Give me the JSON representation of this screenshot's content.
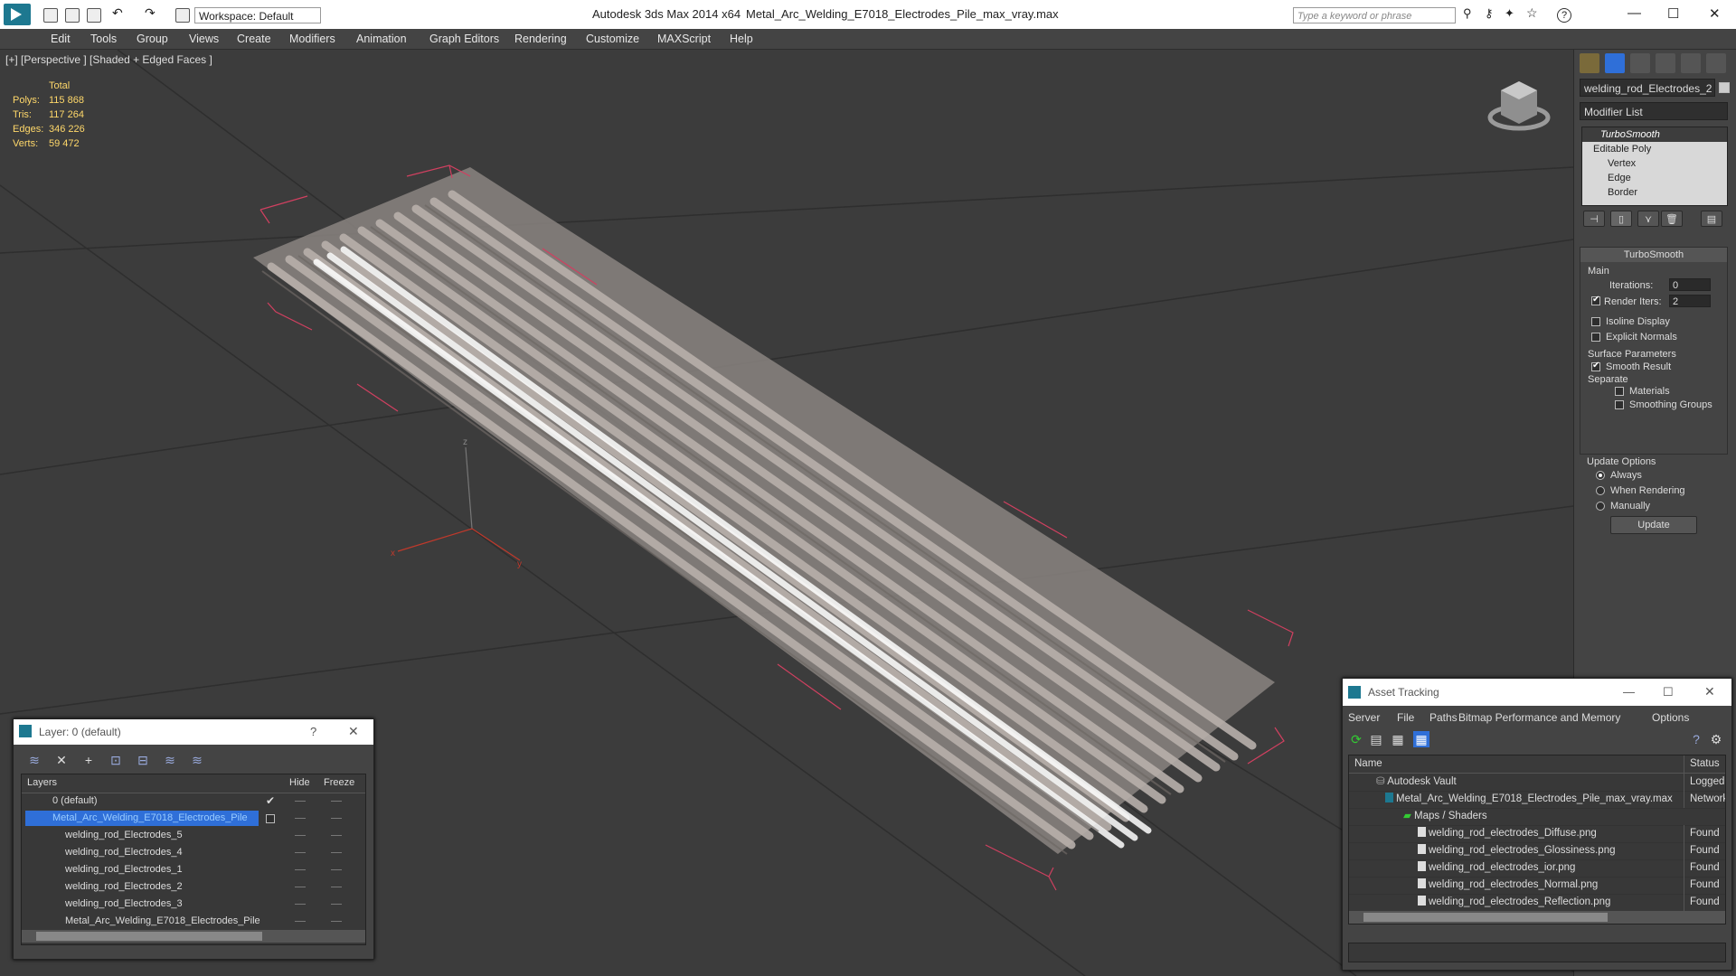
{
  "titlebar": {
    "app": "Autodesk 3ds Max  2014 x64",
    "file": "Metal_Arc_Welding_E7018_Electrodes_Pile_max_vray.max",
    "workspace": "Workspace: Default",
    "search_placeholder": "Type a keyword or phrase"
  },
  "menu": [
    "Edit",
    "Tools",
    "Group",
    "Views",
    "Create",
    "Modifiers",
    "Animation",
    "Graph Editors",
    "Rendering",
    "Customize",
    "MAXScript",
    "Help"
  ],
  "viewport": {
    "label": "[+] [Perspective ] [Shaded + Edged Faces ]",
    "stats": {
      "header": "Total",
      "rows": [
        {
          "label": "Polys:",
          "value": "115 868"
        },
        {
          "label": "Tris:",
          "value": "117 264"
        },
        {
          "label": "Edges:",
          "value": "346 226"
        },
        {
          "label": "Verts:",
          "value": "59 472"
        }
      ]
    },
    "axis": {
      "x": "x",
      "y": "y",
      "z": "z"
    }
  },
  "command_panel": {
    "object_name": "welding_rod_Electrodes_2",
    "modifier_list": "Modifier List",
    "stack": [
      "TurboSmooth",
      "Editable Poly",
      "Vertex",
      "Edge",
      "Border"
    ],
    "rollout_title": "TurboSmooth",
    "main_label": "Main",
    "iterations_label": "Iterations:",
    "iterations_value": "0",
    "render_iters_label": "Render Iters:",
    "render_iters_value": "2",
    "isoline": "Isoline Display",
    "explicit_normals": "Explicit Normals",
    "surface_params": "Surface Parameters",
    "smooth_result": "Smooth Result",
    "separate": "Separate",
    "materials": "Materials",
    "smoothing_groups": "Smoothing Groups",
    "update_options": "Update Options",
    "always": "Always",
    "when_rendering": "When Rendering",
    "manually": "Manually",
    "update_button": "Update"
  },
  "layer_window": {
    "title": "Layer: 0 (default)",
    "help": "?",
    "col_layers": "Layers",
    "col_hide": "Hide",
    "col_freeze": "Freeze",
    "rows": [
      {
        "name": "0 (default)",
        "indent": 0
      },
      {
        "name": "Metal_Arc_Welding_E7018_Electrodes_Pile",
        "indent": 0
      },
      {
        "name": "welding_rod_Electrodes_5",
        "indent": 1
      },
      {
        "name": "welding_rod_Electrodes_4",
        "indent": 1
      },
      {
        "name": "welding_rod_Electrodes_1",
        "indent": 1
      },
      {
        "name": "welding_rod_Electrodes_2",
        "indent": 1
      },
      {
        "name": "welding_rod_Electrodes_3",
        "indent": 1
      },
      {
        "name": "Metal_Arc_Welding_E7018_Electrodes_Pile",
        "indent": 1
      }
    ]
  },
  "asset_window": {
    "title": "Asset Tracking",
    "menu": [
      "Server",
      "File",
      "Paths",
      "Bitmap Performance and Memory",
      "Options"
    ],
    "col_name": "Name",
    "col_status": "Status",
    "rows": [
      {
        "name": "Autodesk Vault",
        "status": "Logged",
        "indent": 1
      },
      {
        "name": "Metal_Arc_Welding_E7018_Electrodes_Pile_max_vray.max",
        "status": "Network",
        "indent": 2
      },
      {
        "name": "Maps / Shaders",
        "status": "",
        "indent": 3
      },
      {
        "name": "welding_rod_electrodes_Diffuse.png",
        "status": "Found",
        "indent": 4
      },
      {
        "name": "welding_rod_electrodes_Glossiness.png",
        "status": "Found",
        "indent": 4
      },
      {
        "name": "welding_rod_electrodes_ior.png",
        "status": "Found",
        "indent": 4
      },
      {
        "name": "welding_rod_electrodes_Normal.png",
        "status": "Found",
        "indent": 4
      },
      {
        "name": "welding_rod_electrodes_Reflection.png",
        "status": "Found",
        "indent": 4
      }
    ]
  },
  "colors": {
    "accent": "#1d7890",
    "selection": "#2f6fd8",
    "stats": "#ffd86a",
    "bbox": "#d04060"
  }
}
